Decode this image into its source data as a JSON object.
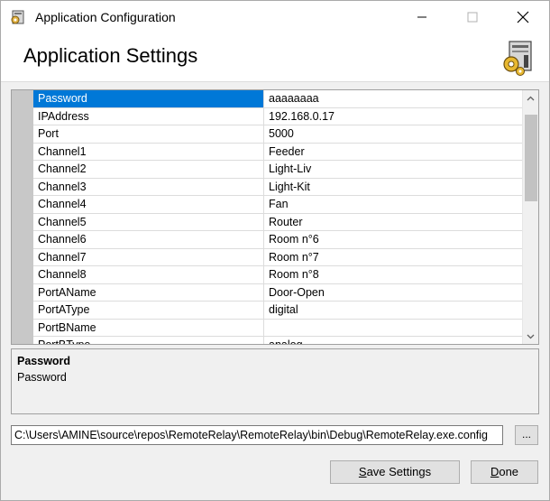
{
  "window": {
    "title": "Application Configuration",
    "icons": {
      "app": "settings-app-icon",
      "header": "config-document-icon"
    }
  },
  "header": {
    "title": "Application Settings"
  },
  "grid": {
    "rows": [
      {
        "name": "Password",
        "value": "aaaaaaaa",
        "selected": true
      },
      {
        "name": "IPAddress",
        "value": "192.168.0.17"
      },
      {
        "name": "Port",
        "value": "5000"
      },
      {
        "name": "Channel1",
        "value": "Feeder"
      },
      {
        "name": "Channel2",
        "value": "Light-Liv"
      },
      {
        "name": "Channel3",
        "value": "Light-Kit"
      },
      {
        "name": "Channel4",
        "value": "Fan"
      },
      {
        "name": "Channel5",
        "value": "Router"
      },
      {
        "name": "Channel6",
        "value": "Room n°6"
      },
      {
        "name": "Channel7",
        "value": "Room n°7"
      },
      {
        "name": "Channel8",
        "value": "Room n°8"
      },
      {
        "name": "PortAName",
        "value": "Door-Open"
      },
      {
        "name": "PortAType",
        "value": "digital"
      },
      {
        "name": "PortBName",
        "value": ""
      },
      {
        "name": "PortBType",
        "value": "analog"
      }
    ]
  },
  "description": {
    "title": "Password",
    "text": "Password"
  },
  "path": {
    "value": "C:\\Users\\AMINE\\source\\repos\\RemoteRelay\\RemoteRelay\\bin\\Debug\\RemoteRelay.exe.config",
    "browse_label": "..."
  },
  "buttons": {
    "save_mnemonic": "S",
    "save_rest": "ave Settings",
    "done_mnemonic": "D",
    "done_rest": "one"
  }
}
